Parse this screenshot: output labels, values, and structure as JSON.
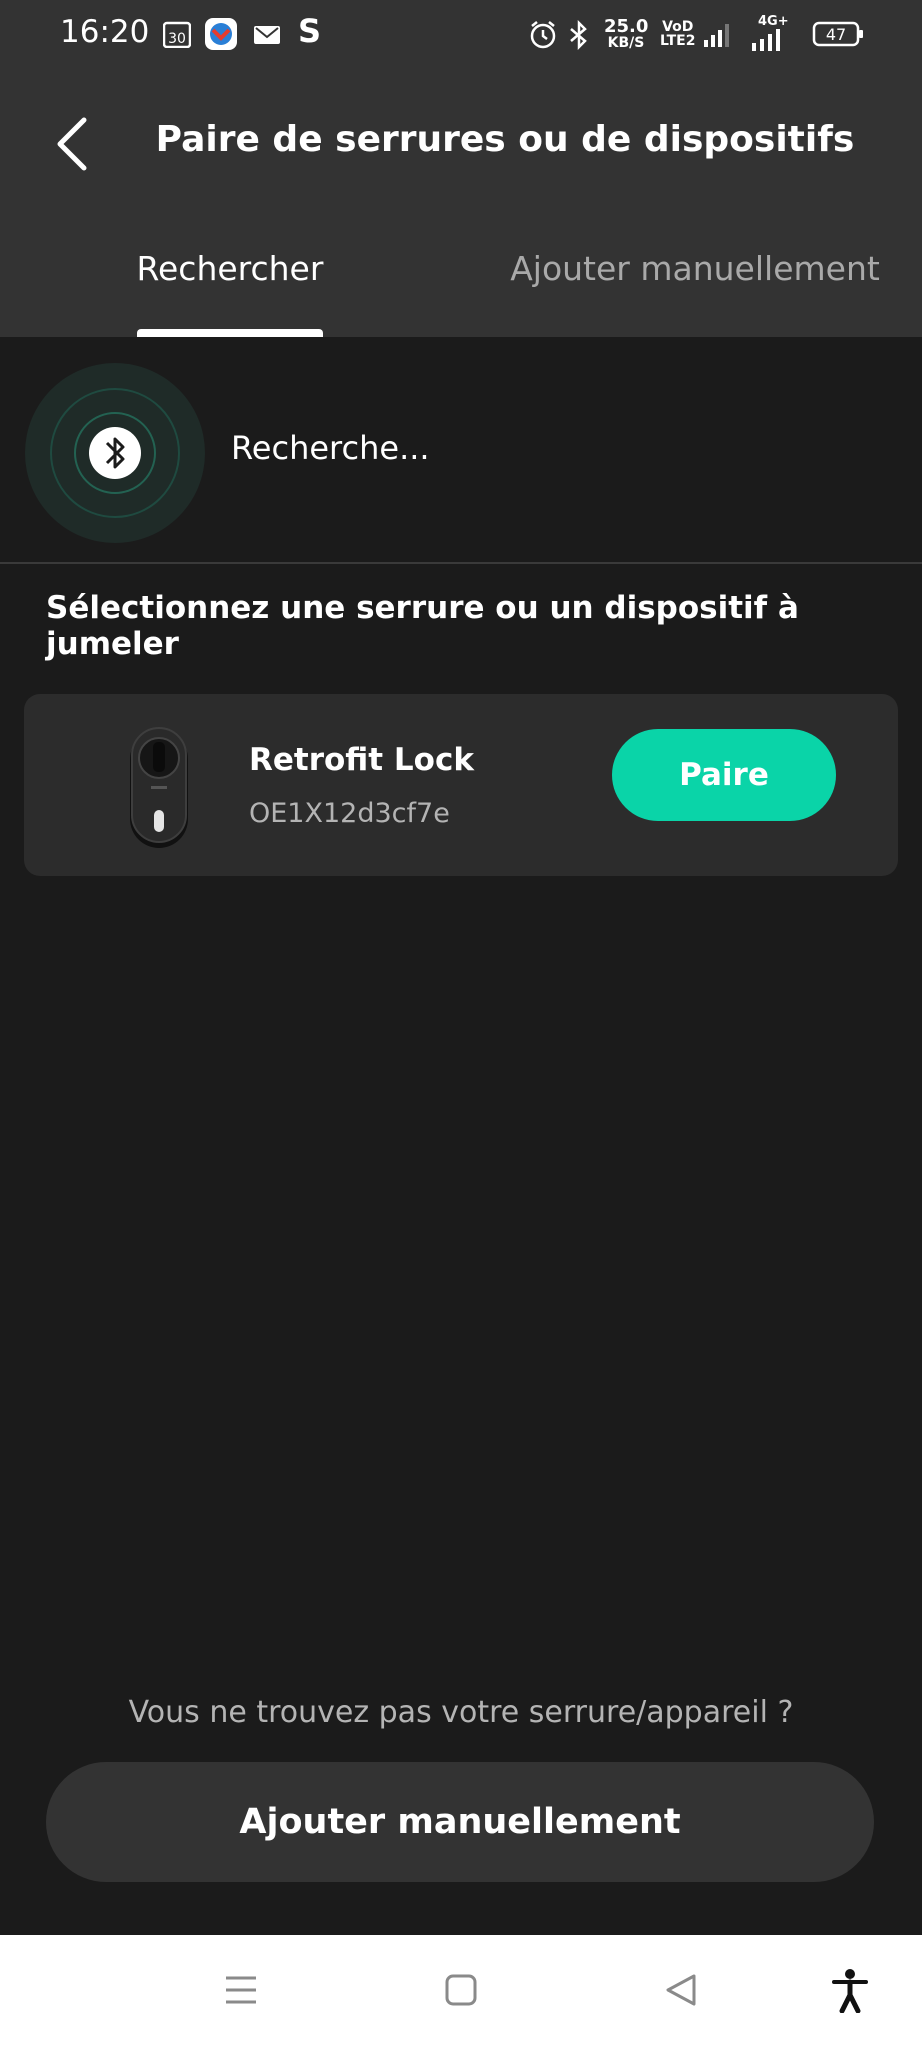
{
  "status_bar": {
    "time": "16:20",
    "calendar_day": "30",
    "s_app": "S",
    "speed_value": "25.0",
    "speed_unit": "KB/S",
    "volte_top": "VoD",
    "volte_bottom": "LTE2",
    "network": "4G+",
    "battery": "47"
  },
  "header": {
    "title": "Paire de serrures ou de dispositifs"
  },
  "tabs": [
    {
      "label": "Rechercher",
      "active": true
    },
    {
      "label": "Ajouter manuellement",
      "active": false
    }
  ],
  "search": {
    "status_text": "Recherche..."
  },
  "section": {
    "title": "Sélectionnez une serrure ou un dispositif à jumeler"
  },
  "devices": [
    {
      "name": "Retrofit Lock",
      "id": "OE1X12d3cf7e",
      "button_label": "Paire"
    }
  ],
  "footer": {
    "hint": "Vous ne trouvez pas votre serrure/appareil ?",
    "manual_button": "Ajouter manuellement"
  },
  "colors": {
    "accent": "#0ad4a8",
    "background": "#1b1b1b",
    "header": "#333333",
    "card": "#2c2c2c"
  }
}
